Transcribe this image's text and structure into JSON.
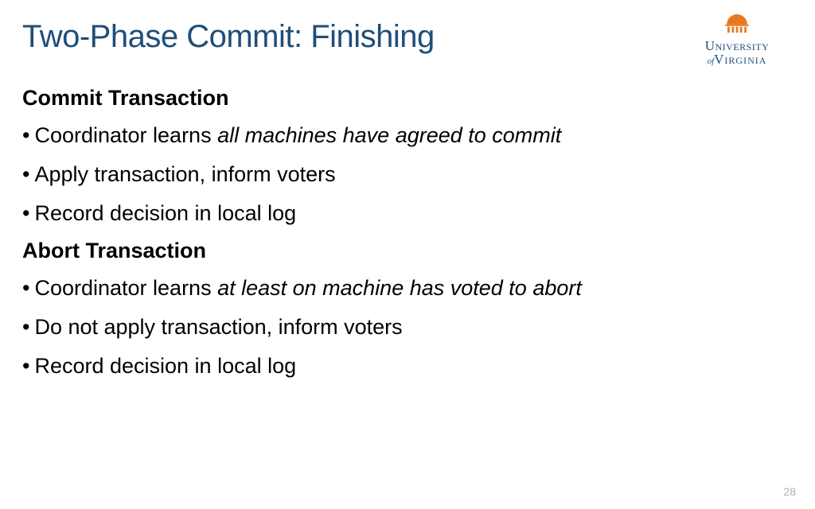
{
  "title": "Two-Phase Commit: Finishing",
  "logo": {
    "line1": "University",
    "line2_prefix": "of",
    "line2": "Virginia"
  },
  "sections": [
    {
      "header": "Commit Transaction",
      "bullets": [
        {
          "plain": "Coordinator learns ",
          "italic": "all machines have agreed to commit"
        },
        {
          "plain": "Apply transaction, inform voters"
        },
        {
          "plain": "Record decision in local log"
        }
      ]
    },
    {
      "header": "Abort Transaction",
      "bullets": [
        {
          "plain": "Coordinator learns ",
          "italic": "at least on machine has voted to abort"
        },
        {
          "plain": "Do not apply transaction, inform voters"
        },
        {
          "plain": "Record decision in local log"
        }
      ]
    }
  ],
  "page_number": "28"
}
